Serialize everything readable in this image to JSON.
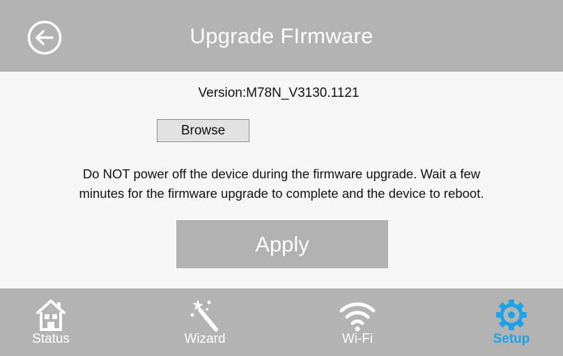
{
  "header": {
    "title": "Upgrade FIrmware",
    "back_icon": "arrow-left-circle-icon"
  },
  "main": {
    "version_text": "Version:M78N_V3130.1121",
    "browse_label": "Browse",
    "notice_line1": "Do NOT power off the device during the firmware upgrade. Wait a few",
    "notice_line2": "minutes for the firmware upgrade to complete and the device to reboot.",
    "apply_label": "Apply"
  },
  "nav": {
    "items": [
      {
        "label": "Status",
        "icon": "house-icon",
        "active": false
      },
      {
        "label": "Wizard",
        "icon": "magic-wand-icon",
        "active": false
      },
      {
        "label": "Wi-Fi",
        "icon": "wifi-icon",
        "active": false
      },
      {
        "label": "Setup",
        "icon": "gear-icon",
        "active": true
      }
    ]
  },
  "colors": {
    "bar": "#b3b3b3",
    "active": "#1aa3e8",
    "content_bg": "#f7f7f7"
  }
}
